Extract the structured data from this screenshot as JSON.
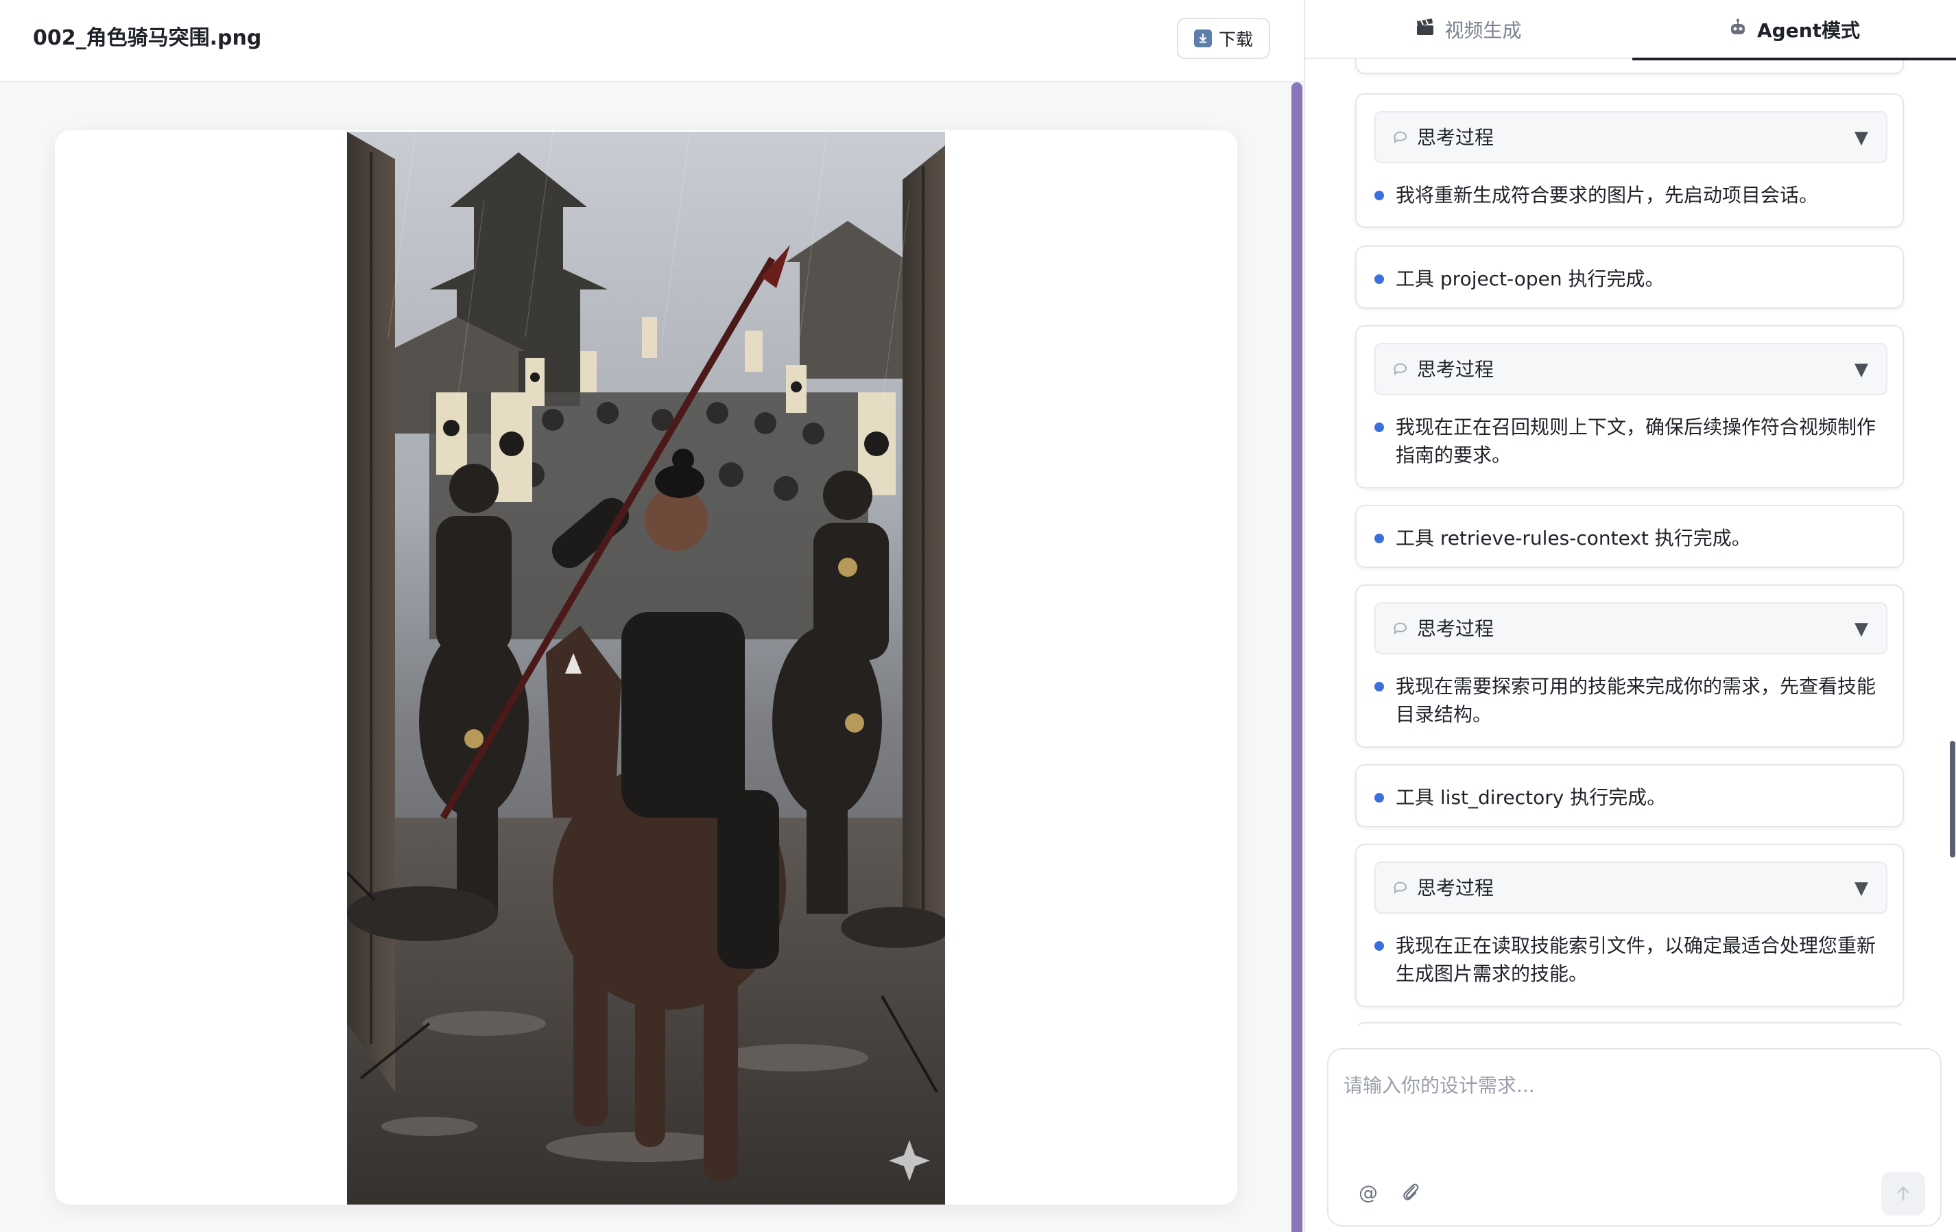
{
  "file": {
    "name": "002_角色骑马突围.png",
    "download_label": "下载",
    "download_icon": "download-arrow-icon"
  },
  "tabs": [
    {
      "label": "视频生成",
      "icon": "clapperboard-icon",
      "active": false
    },
    {
      "label": "Agent模式",
      "icon": "robot-icon",
      "active": true
    }
  ],
  "messages": {
    "thinking_label": "思考过程",
    "items": [
      {
        "type": "thinking",
        "text": "我将重新生成符合要求的图片，先启动项目会话。"
      },
      {
        "type": "tool",
        "text": "工具 project-open 执行完成。"
      },
      {
        "type": "thinking",
        "text": "我现在正在召回规则上下文，确保后续操作符合视频制作指南的要求。"
      },
      {
        "type": "tool",
        "text": "工具 retrieve-rules-context 执行完成。"
      },
      {
        "type": "thinking",
        "text": "我现在需要探索可用的技能来完成你的需求，先查看技能目录结构。"
      },
      {
        "type": "tool",
        "text": "工具 list_directory 执行完成。"
      },
      {
        "type": "thinking",
        "text": "我现在正在读取技能索引文件，以确定最适合处理您重新生成图片需求的技能。"
      }
    ]
  },
  "composer": {
    "placeholder": "请输入你的设计需求...",
    "value": "",
    "mention_symbol": "@"
  },
  "colors": {
    "accent": "#3b6fe0",
    "left_scrollbar": "#8877b8",
    "active_tab_underline": "#1f2329"
  }
}
